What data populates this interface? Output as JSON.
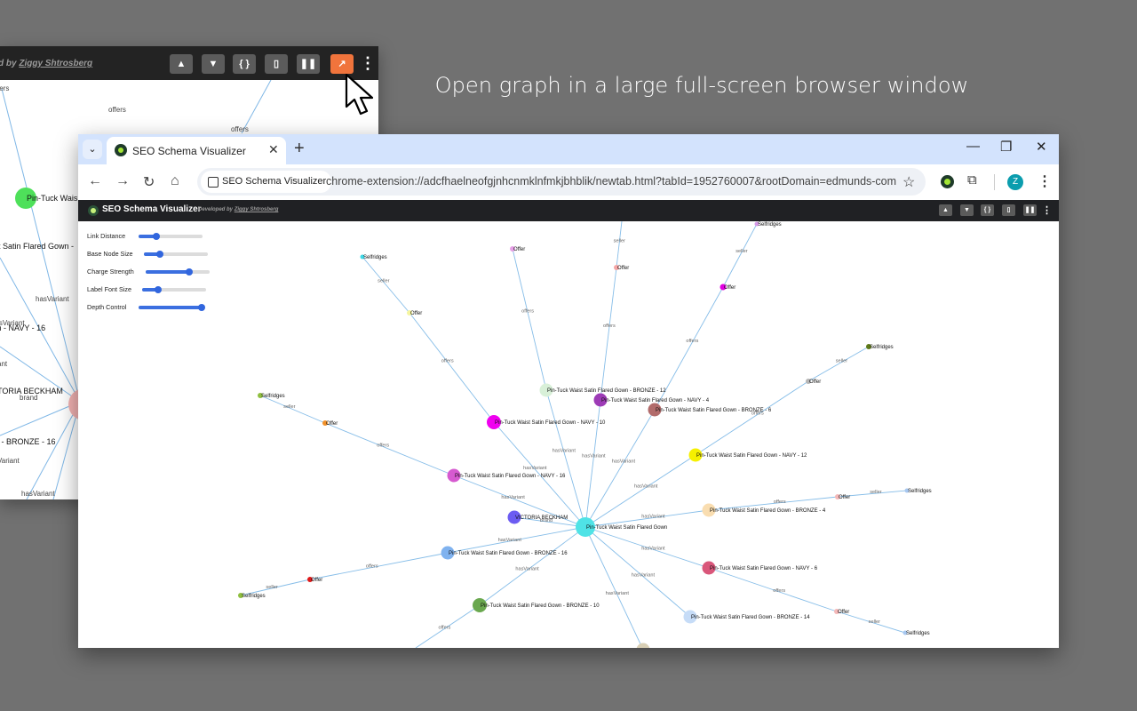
{
  "caption": "Open graph in a large full-screen browser window",
  "background_window": {
    "developer_text": "d by",
    "developer_link": "Ziggy Shtrosberg",
    "toolbar_buttons": [
      {
        "icon": "warning-icon",
        "glyph": "▲"
      },
      {
        "icon": "filter-icon",
        "glyph": "▼"
      },
      {
        "icon": "braces-icon",
        "glyph": "{ }"
      },
      {
        "icon": "clipboard-icon",
        "glyph": "▯"
      },
      {
        "icon": "pause-icon",
        "glyph": "❚❚"
      },
      {
        "icon": "open-external-icon",
        "glyph": "↗"
      }
    ],
    "kebab_glyph": "⋮",
    "labels": {
      "offers_top": "offers",
      "offers_mid": "offers",
      "node_green": "Pin-Tuck Wais",
      "gown_partial": "t Satin Flared Gown -",
      "has_variant_1": "hasVariant",
      "has_variant_2": "hasVariant",
      "navy_16": "wn - NAVY - 16",
      "brand_victoria": "TORIA BECKHAM",
      "brand": "brand",
      "bronze_16": "n - BRONZE - 16",
      "has_variant_3": "Variant",
      "has_variant_4": "hasVariant",
      "fers": "fers",
      "ant": "ant"
    }
  },
  "browser": {
    "tab_menu_glyph": "⌄",
    "tab_title": "SEO Schema Visualizer",
    "tab_close": "✕",
    "new_tab": "+",
    "window_controls": [
      "—",
      "❐",
      "✕"
    ],
    "nav": {
      "back": "←",
      "forward": "→",
      "reload": "↻",
      "home": "⌂"
    },
    "address_chip": "SEO Schema Visualizer",
    "url": "chrome-extension://adcfhaelneofgjnhcnmklnfmkjbhblik/newtab.html?tabId=1952760007&rootDomain=edmunds-com",
    "star": "☆",
    "puzzle": "⧉",
    "avatar": "Z",
    "menu": "⋮"
  },
  "app": {
    "title": "SEO Schema Visualizer",
    "developer_text": "Developed by",
    "developer_link": "Ziggy Shtrosberg",
    "buttons": [
      "▲",
      "▼",
      "{ }",
      "▯",
      "❚❚"
    ],
    "kebab": "⋮"
  },
  "controls": [
    {
      "label": "Link Distance",
      "value": 0.28
    },
    {
      "label": "Base Node Size",
      "value": 0.25
    },
    {
      "label": "Charge Strength",
      "value": 0.68
    },
    {
      "label": "Label Font Size",
      "value": 0.25
    },
    {
      "label": "Depth Control",
      "value": 0.98
    }
  ],
  "graph": {
    "nodes": [
      {
        "id": "root",
        "label": "Pin-Tuck Waist Satin Flared Gown",
        "color": "#4fe3e6"
      },
      {
        "id": "victoria",
        "label": "VICTORIA BECKHAM",
        "color": "#6c5cf2"
      },
      {
        "id": "bronze12",
        "label": "Pin-Tuck Waist Satin Flared Gown - BRONZE - 12",
        "color": "#d8f0d8"
      },
      {
        "id": "navy4",
        "label": "Pin-Tuck Waist Satin Flared Gown - NAVY - 4",
        "color": "#9d3bb6"
      },
      {
        "id": "bronze6",
        "label": "Pin-Tuck Waist Satin Flared Gown - BRONZE - 6",
        "color": "#b16b6b"
      },
      {
        "id": "navy10",
        "label": "Pin-Tuck Waist Satin Flared Gown - NAVY - 10",
        "color": "#f000f0"
      },
      {
        "id": "navy12",
        "label": "Pin-Tuck Waist Satin Flared Gown - NAVY - 12",
        "color": "#f6f000"
      },
      {
        "id": "navy16",
        "label": "Pin-Tuck Waist Satin Flared Gown - NAVY - 16",
        "color": "#d65ad0"
      },
      {
        "id": "bronze4",
        "label": "Pin-Tuck Waist Satin Flared Gown - BRONZE - 4",
        "color": "#f9ddb0"
      },
      {
        "id": "bronze16",
        "label": "Pin-Tuck Waist Satin Flared Gown - BRONZE - 16",
        "color": "#7fb2ef"
      },
      {
        "id": "navy6",
        "label": "Pin-Tuck Waist Satin Flared Gown - NAVY - 6",
        "color": "#d9567a"
      },
      {
        "id": "bronze10",
        "label": "Pin-Tuck Waist Satin Flared Gown - BRONZE - 10",
        "color": "#6aa84f"
      },
      {
        "id": "bronze14",
        "label": "Pin-Tuck Waist Satin Flared Gown - BRONZE - 14",
        "color": "#c6dcf7"
      },
      {
        "id": "bronze8",
        "label": "Pin-Tuck Waist Satin Flared Gown - BRONZE - 8",
        "color": "#d8cfb5"
      },
      {
        "id": "o1",
        "label": "Offer",
        "color": "#e6a0e6"
      },
      {
        "id": "o2",
        "label": "Offer",
        "color": "#f4a6a6"
      },
      {
        "id": "o3",
        "label": "Offer",
        "color": "#e000e0"
      },
      {
        "id": "o4",
        "label": "Offer",
        "color": "#f5f5a0"
      },
      {
        "id": "o5",
        "label": "Offer",
        "color": "#b5b5b5"
      },
      {
        "id": "o6",
        "label": "Offer",
        "color": "#f0902a"
      },
      {
        "id": "o7",
        "label": "Offer",
        "color": "#f4b8b8"
      },
      {
        "id": "o8",
        "label": "Offer",
        "color": "#e01818"
      },
      {
        "id": "o9",
        "label": "Offer",
        "color": "#f4b8b8"
      },
      {
        "id": "s1",
        "label": "Selfridges",
        "color": "#d59ae6"
      },
      {
        "id": "s2",
        "label": "Selfridges",
        "color": "#3fd8e6"
      },
      {
        "id": "s3",
        "label": "Selfridges",
        "color": "#5e7a18"
      },
      {
        "id": "s4",
        "label": "Selfridges",
        "color": "#8fbf3f"
      },
      {
        "id": "s5",
        "label": "Selfridges",
        "color": "#a8c8f0"
      },
      {
        "id": "s6",
        "label": "Selfridges",
        "color": "#8fbf3f"
      },
      {
        "id": "s7",
        "label": "Selfridges",
        "color": "#a8c8f0"
      }
    ],
    "edge_labels": {
      "has_variant": "hasVariant",
      "offers": "offers",
      "seller": "seller",
      "brand": "brand"
    }
  }
}
